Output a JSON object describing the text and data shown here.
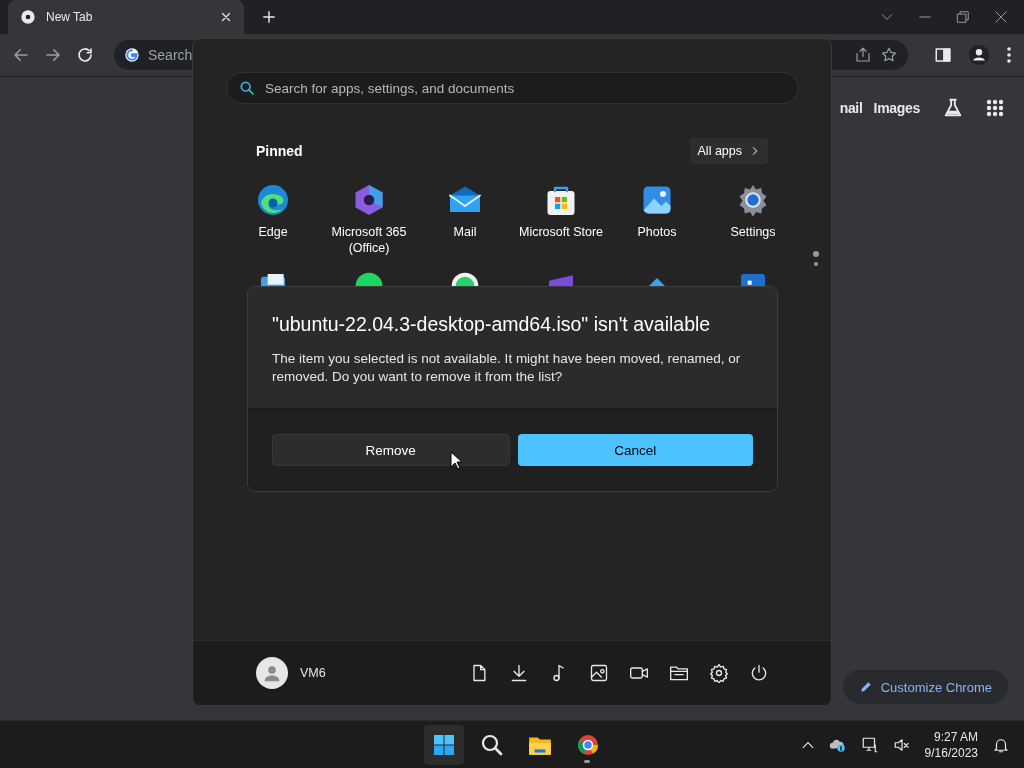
{
  "browser": {
    "tab": {
      "title": "New Tab",
      "selected": true
    },
    "address": {
      "placeholder": "Search"
    },
    "links": [
      "nail",
      "Images"
    ],
    "customize_button": "Customize Chrome"
  },
  "start_menu": {
    "search": {
      "placeholder": "Search for apps, settings, and documents"
    },
    "pinned_title": "Pinned",
    "all_apps": "All apps",
    "apps": [
      {
        "label": "Edge",
        "kind": "edge"
      },
      {
        "label": "Microsoft 365 (Office)",
        "kind": "office"
      },
      {
        "label": "Mail",
        "kind": "mail"
      },
      {
        "label": "Microsoft Store",
        "kind": "store"
      },
      {
        "label": "Photos",
        "kind": "photos"
      },
      {
        "label": "Settings",
        "kind": "settings"
      }
    ],
    "user": "VM6"
  },
  "dialog": {
    "title": "\"ubuntu-22.04.3-desktop-amd64.iso\" isn't available",
    "message": "The item you selected is not available. It might have been moved, renamed, or removed. Do you want to remove it from the list?",
    "buttons": [
      {
        "label": "Remove",
        "kind": "secondary"
      },
      {
        "label": "Cancel",
        "kind": "primary"
      }
    ]
  },
  "taskbar": {
    "time": "9:27 AM",
    "date": "9/16/2023"
  }
}
